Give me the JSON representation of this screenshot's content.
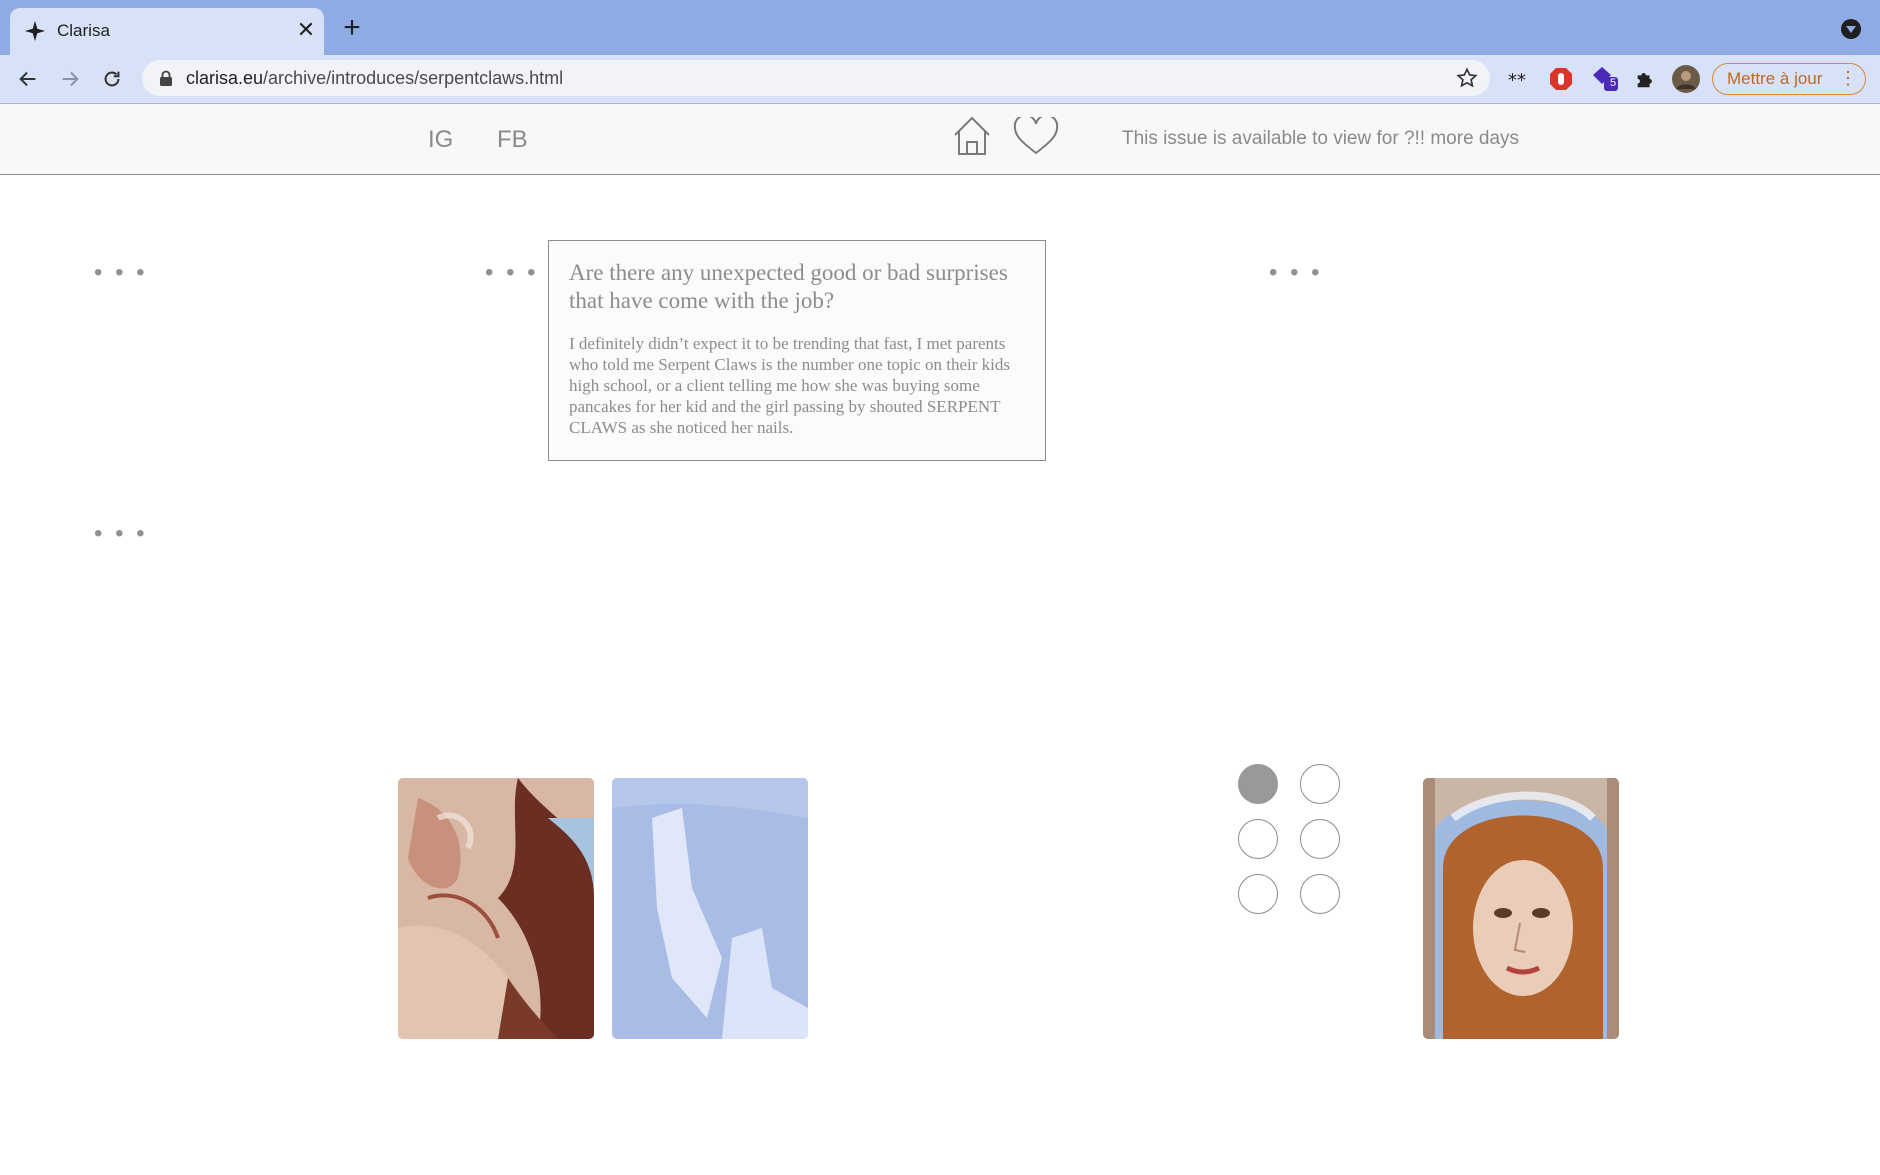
{
  "browser": {
    "tab_title": "Clarisa",
    "url_domain": "clarisa.eu",
    "url_path": "/archive/introduces/serpentclaws.html",
    "update_button": "Mettre à jour",
    "extension_badge": "5",
    "accent_colors": {
      "tabbar": "#8eabe3",
      "toolbar": "#d7e1f8",
      "update": "#d9873a"
    }
  },
  "header": {
    "links": [
      "IG",
      "FB"
    ],
    "availability_text": "This issue is available to view for ?!! more days"
  },
  "ellipses": [
    "• • •",
    "• • •",
    "• • •",
    "• • •"
  ],
  "qa": {
    "question": "Are there any unexpected good or bad surprises that have come with the job?",
    "answer": "I definitely didn’t expect it to be trending that fast, I met parents who told me Serpent Claws is the number one topic on their kids high school, or a client telling me how she was buying some pancakes for her kid and the girl passing by shouted SERPENT CLAWS as she noticed her nails."
  },
  "gallery": {
    "images": [
      "nail-art-painted-woman-closeup",
      "nail-art-pale-blue-white-strokes",
      "nail-art-portrait-red-hair"
    ],
    "pager": {
      "total": 6,
      "active_index": 0
    }
  }
}
